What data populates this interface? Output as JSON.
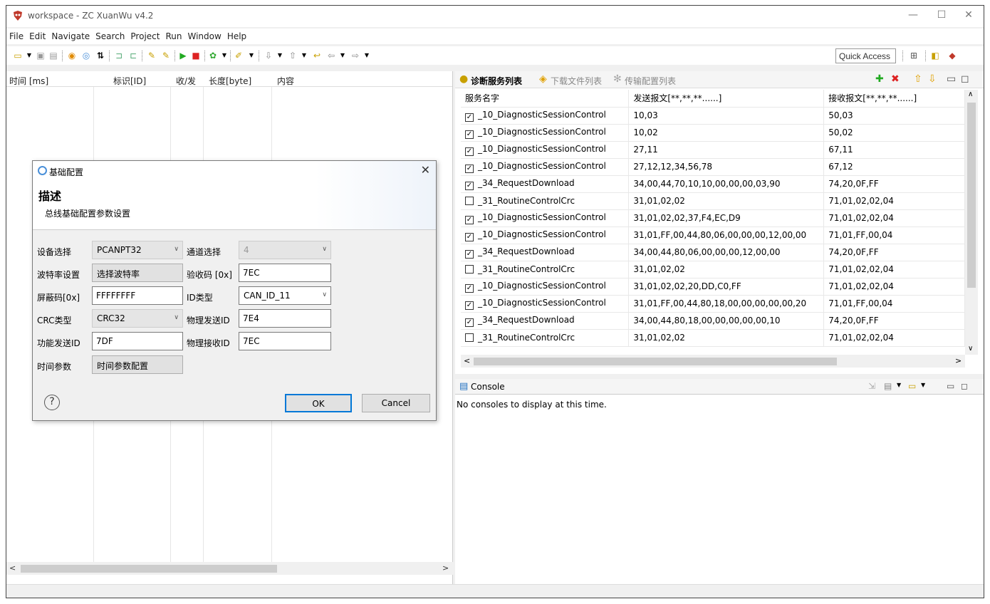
{
  "window": {
    "title": "workspace - ZC XuanWu v4.2"
  },
  "menu": [
    "File",
    "Edit",
    "Navigate",
    "Search",
    "Project",
    "Run",
    "Window",
    "Help"
  ],
  "toolbar": {
    "quick_access": "Quick Access"
  },
  "message_table": {
    "columns": [
      "时间 [ms]",
      "标识[ID]",
      "收/发",
      "长度[byte]",
      "内容"
    ]
  },
  "dialog": {
    "title": "基础配置",
    "heading": "描述",
    "subtitle": "总线基础配置参数设置",
    "device_label": "设备选择",
    "device_value": "PCANPT32",
    "channel_label": "通道选择",
    "channel_value": "4",
    "baud_label": "波特率设置",
    "baud_button": "选择波特率",
    "verify_label": "验收码 [0x]",
    "verify_value": "7EC",
    "mask_label": "屏蔽码[0x]",
    "mask_value": "FFFFFFFF",
    "idtype_label": "ID类型",
    "idtype_value": "CAN_ID_11",
    "crc_label": "CRC类型",
    "crc_value": "CRC32",
    "phys_send_label": "物理发送ID",
    "phys_send_value": "7E4",
    "func_send_label": "功能发送ID",
    "func_send_value": "7DF",
    "phys_recv_label": "物理接收ID",
    "phys_recv_value": "7EC",
    "time_label": "时间参数",
    "time_button": "时间参数配置",
    "help": "?",
    "ok": "OK",
    "cancel": "Cancel"
  },
  "service_panel": {
    "tabs": [
      "诊断服务列表",
      "下载文件列表",
      "传输配置列表"
    ],
    "columns": [
      "服务名字",
      "发送报文[**,**,**......]",
      "接收报文[**,**,**......]"
    ],
    "rows": [
      {
        "checked": true,
        "name": "_10_DiagnosticSessionControl",
        "send": "10,03",
        "recv": "50,03"
      },
      {
        "checked": true,
        "name": "_10_DiagnosticSessionControl",
        "send": "10,02",
        "recv": "50,02"
      },
      {
        "checked": true,
        "name": "_10_DiagnosticSessionControl",
        "send": "27,11",
        "recv": "67,11"
      },
      {
        "checked": true,
        "name": "_10_DiagnosticSessionControl",
        "send": "27,12,12,34,56,78",
        "recv": "67,12"
      },
      {
        "checked": true,
        "name": "_34_RequestDownload",
        "send": "34,00,44,70,10,10,00,00,00,03,90",
        "recv": "74,20,0F,FF"
      },
      {
        "checked": false,
        "name": "_31_RoutineControlCrc",
        "send": "31,01,02,02",
        "recv": "71,01,02,02,04"
      },
      {
        "checked": true,
        "name": "_10_DiagnosticSessionControl",
        "send": "31,01,02,02,37,F4,EC,D9",
        "recv": "71,01,02,02,04"
      },
      {
        "checked": true,
        "name": "_10_DiagnosticSessionControl",
        "send": "31,01,FF,00,44,80,06,00,00,00,12,00,00",
        "recv": "71,01,FF,00,04"
      },
      {
        "checked": true,
        "name": "_34_RequestDownload",
        "send": "34,00,44,80,06,00,00,00,12,00,00",
        "recv": "74,20,0F,FF"
      },
      {
        "checked": false,
        "name": "_31_RoutineControlCrc",
        "send": "31,01,02,02",
        "recv": "71,01,02,02,04"
      },
      {
        "checked": true,
        "name": "_10_DiagnosticSessionControl",
        "send": "31,01,02,02,20,DD,C0,FF",
        "recv": "71,01,02,02,04"
      },
      {
        "checked": true,
        "name": "_10_DiagnosticSessionControl",
        "send": "31,01,FF,00,44,80,18,00,00,00,00,00,20",
        "recv": "71,01,FF,00,04"
      },
      {
        "checked": true,
        "name": "_34_RequestDownload",
        "send": "34,00,44,80,18,00,00,00,00,00,10",
        "recv": "74,20,0F,FF"
      },
      {
        "checked": false,
        "name": "_31_RoutineControlCrc",
        "send": "31,01,02,02",
        "recv": "71,01,02,02,04"
      }
    ]
  },
  "console": {
    "tab": "Console",
    "message": "No consoles to display at this time."
  }
}
